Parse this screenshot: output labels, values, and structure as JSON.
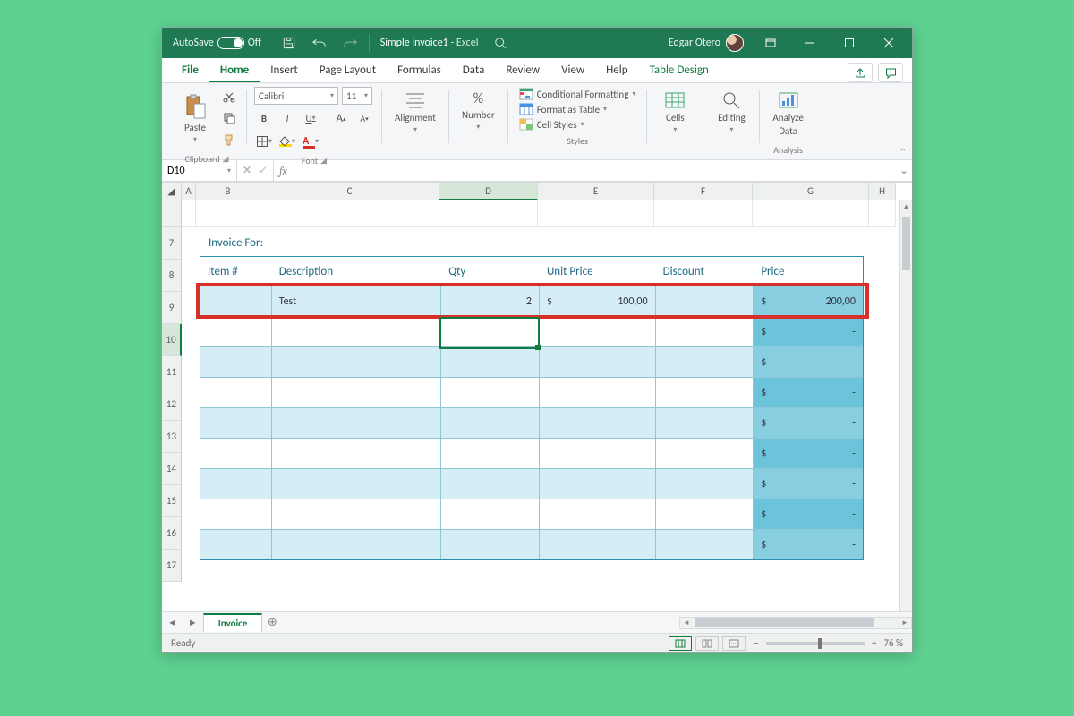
{
  "title": {
    "autosave": "AutoSave",
    "off": "Off",
    "doc": "Simple invoice1",
    "sep": "-",
    "app": "Excel",
    "user": "Edgar Otero"
  },
  "tabs": {
    "file": "File",
    "home": "Home",
    "insert": "Insert",
    "page_layout": "Page Layout",
    "formulas": "Formulas",
    "data": "Data",
    "review": "Review",
    "view": "View",
    "help": "Help",
    "table_design": "Table Design"
  },
  "ribbon": {
    "clipboard": "Clipboard",
    "paste": "Paste",
    "font": "Font",
    "font_name": "Calibri",
    "font_size": "11",
    "alignment": "Alignment",
    "number": "Number",
    "styles": "Styles",
    "cond_fmt": "Conditional Formatting",
    "fmt_table": "Format as Table",
    "cell_styles": "Cell Styles",
    "cells": "Cells",
    "editing": "Editing",
    "analysis": "Analysis",
    "analyze": "Analyze",
    "analyze2": "Data"
  },
  "fx": {
    "cell": "D10",
    "fx": "fx"
  },
  "columns": [
    "",
    "A",
    "B",
    "C",
    "D",
    "E",
    "F",
    "G",
    "H"
  ],
  "rows": [
    "",
    "7",
    "8",
    "9",
    "10",
    "11",
    "12",
    "13",
    "14",
    "15",
    "16",
    "17"
  ],
  "invoice": {
    "for": "Invoice For:",
    "head": {
      "item": "Item #",
      "desc": "Description",
      "qty": "Qty",
      "unit_price": "Unit Price",
      "discount": "Discount",
      "price": "Price"
    },
    "row1": {
      "desc": "Test",
      "qty": "2",
      "currency": "$",
      "unit_price": "100,00",
      "price": "200,00"
    },
    "placeholder_currency": "$",
    "placeholder_dash": "-"
  },
  "sheet_tab": "Invoice",
  "status": {
    "ready": "Ready",
    "zoom": "76 %"
  }
}
